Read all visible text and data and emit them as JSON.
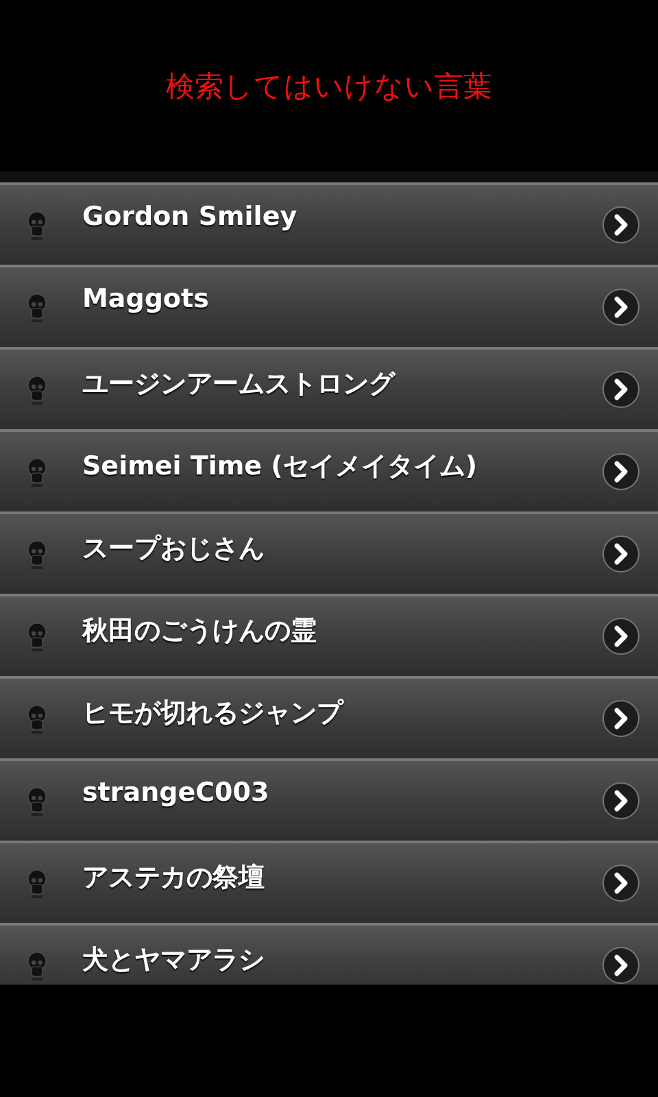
{
  "header": {
    "title": "検索してはいけない言葉"
  },
  "items": [
    {
      "label": "Gordon Smiley"
    },
    {
      "label": "Maggots"
    },
    {
      "label": "ユージンアームストロング"
    },
    {
      "label": "Seimei Time (セイメイタイム)"
    },
    {
      "label": "スープおじさん"
    },
    {
      "label": "秋田のごうけんの霊"
    },
    {
      "label": "ヒモが切れるジャンプ"
    },
    {
      "label": "strangeC003"
    },
    {
      "label": "アステカの祭壇"
    },
    {
      "label": "犬とヤマアラシ"
    }
  ]
}
